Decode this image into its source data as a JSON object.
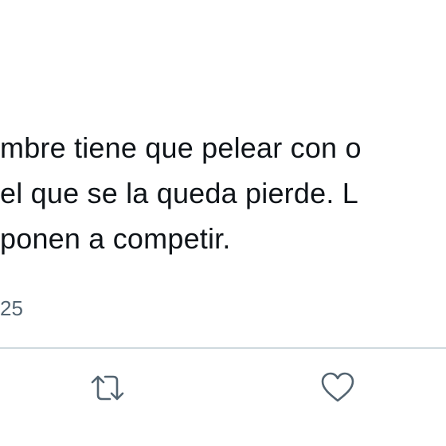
{
  "tweet": {
    "lines": [
      "mbre tiene que pelear con o",
      "el que se la queda pierde. L",
      "ponen a competir."
    ],
    "timestamp": "25"
  },
  "actions": {
    "retweet_icon": "retweet-icon",
    "like_icon": "heart-icon"
  },
  "colors": {
    "text": "#0f1419",
    "secondary": "#536471",
    "divider": "#cfd9de",
    "background": "#ffffff"
  }
}
